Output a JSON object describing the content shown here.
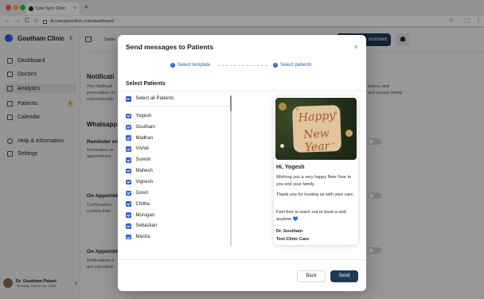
{
  "browser": {
    "tab_title": "Care Sync Clinic",
    "tab_close": "×",
    "new_tab": "+",
    "url": "dr.caresyncclinic.com/dashboard",
    "nav_back": "←",
    "nav_forward": "→",
    "nav_reload": "C",
    "nav_home": "⌂",
    "star": "☆",
    "menu": "⋮"
  },
  "sidebar": {
    "clinic_name": "Goutham Clinic",
    "items": [
      {
        "label": "Dashboard"
      },
      {
        "label": "Doctors"
      },
      {
        "label": "Analytics"
      },
      {
        "label": "Patients",
        "badge": "1"
      },
      {
        "label": "Calendar"
      },
      {
        "label": "Help & Information"
      },
      {
        "label": "Settings"
      }
    ],
    "user": {
      "name": "Dr. Goutham Palani",
      "date": "Tuesday, March 18, 2025"
    }
  },
  "topbar": {
    "breadcrumb": "Settin",
    "appointment_button": "ointment"
  },
  "background": {
    "notifications_heading": "Notificati",
    "notifications_desc_1": "The Notificati",
    "notifications_desc_2": "prescription no",
    "notifications_desc_3": "communicatio",
    "notifications_right_1": "inders, and",
    "notifications_right_2": "and ensure timely",
    "whatsapp_heading": "Whatsapp",
    "reminder_title": "Reminder on",
    "reminder_desc_1": "Reminders se",
    "reminder_desc_2": "appointment.",
    "appt1_title": "On Appointm",
    "appt1_desc_1": "Confirmation",
    "appt1_desc_2": "confirm their",
    "appt2_title": "On Appointm",
    "appt2_desc_1": "Notifications s",
    "appt2_desc_2": "are cancelled."
  },
  "modal": {
    "title": "Send messages to Patients",
    "close": "×",
    "step_1": "Select template",
    "step_2": "Select patients",
    "section_title": "Select Patients",
    "select_all": "Select all Pateints",
    "patients": [
      "Yogesh",
      "Goutham",
      "Madhan",
      "Vishal",
      "Suresh",
      "Mahesh",
      "Vignesh",
      "Gowri",
      "Chitha",
      "Murugan",
      "Sebastian",
      "Macha"
    ],
    "preview": {
      "image_text_1": "Happy",
      "image_text_2": "New Year",
      "greeting": "Hi, Yogesh",
      "line_1": "Wishing you a very happy New Year to you and your family",
      "line_2": "Thank you for trusting us with your care.",
      "line_3": "Feel free to reach out or book a visit anytime 💙",
      "signature_1": "Dr. Goutham",
      "signature_2": "Test Clinic Care"
    },
    "back_button": "Back",
    "send_button": "Send"
  },
  "colors": {
    "accent": "#2c62c9",
    "primary_dark": "#1f3a57"
  }
}
